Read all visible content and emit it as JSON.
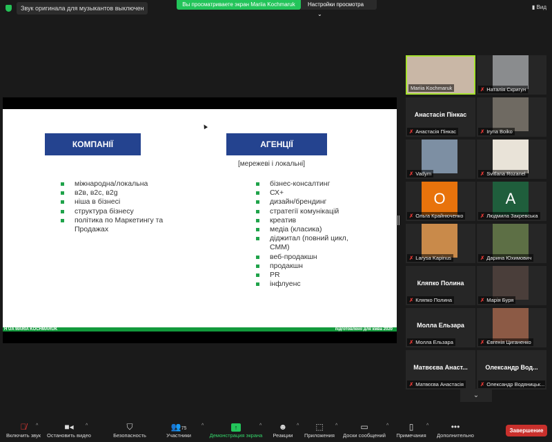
{
  "topbar": {
    "audio_note": "Звук оригинала для музыкантов выключен",
    "viewing": "Вы просматриваете экран Mariia Kochmaruk",
    "view_options": "Настройки просмотра",
    "view_button": "Вид"
  },
  "slide": {
    "left_header": "КОМПАНІЇ",
    "right_header": "АГЕНЦІЇ",
    "right_subheader": "[мережеві і локальні]",
    "left_items": [
      "міжнародна/локальна",
      "в2в, в2с, в2g",
      "ніша в бізнесі",
      "структура бізнесу",
      "політика по Маркетингу та Продажах"
    ],
    "right_items": [
      "бізнес-консалтинг",
      "СХ+",
      "дизайн/брендинг",
      "стратегії комунікацій",
      "креатив",
      "медіа (класика)",
      "діджитал (повний цикл, СММ)",
      "веб-продакшн",
      "продакшн",
      "PR",
      "інфлуенс"
    ],
    "footer_left": "H  UA   MARIA KOCHMARUK",
    "footer_right": "підготовлено для кмва  2020"
  },
  "participants": [
    {
      "name": "Mariia Kochmaruk",
      "type": "video",
      "color": "#c9b7a6",
      "muted": false,
      "active": true
    },
    {
      "name": "Наталія  Скригун",
      "type": "video",
      "color": "#8a8c8e",
      "muted": true
    },
    {
      "name": "Анастасія Пінкас",
      "type": "name",
      "big": "Анастасія Пінкас",
      "muted": true
    },
    {
      "name": "Iryna Boiko",
      "type": "video",
      "color": "#6f6a62",
      "muted": true
    },
    {
      "name": "Vadym",
      "type": "video",
      "color": "#7d8fa3",
      "muted": true
    },
    {
      "name": "Svitlana Rozanel",
      "type": "video",
      "color": "#e9e3d8",
      "muted": true
    },
    {
      "name": "Ольга Крайнюченко",
      "type": "letter",
      "letter": "O",
      "color": "#e8730c",
      "muted": true
    },
    {
      "name": "Людмила Закревська",
      "type": "letter",
      "letter": "A",
      "color": "#1f5e3c",
      "muted": true
    },
    {
      "name": "Larysa Kapinus",
      "type": "video",
      "color": "#c98a4a",
      "muted": true
    },
    {
      "name": "Дарина Юхимович",
      "type": "video",
      "color": "#5d6f45",
      "muted": true
    },
    {
      "name": "Кляпко Полина",
      "type": "name",
      "big": "Кляпко Полина",
      "muted": true
    },
    {
      "name": "Марія Буря",
      "type": "video",
      "color": "#4a3e3a",
      "muted": true
    },
    {
      "name": "Молла Ельзара",
      "type": "name",
      "big": "Молла Ельзара",
      "muted": true
    },
    {
      "name": "Євгенія Циганенко",
      "type": "video",
      "color": "#8c5a45",
      "muted": true
    },
    {
      "name": "Матвєєва Анастасія",
      "type": "name",
      "big": "Матвєєва Анаст...",
      "muted": true
    },
    {
      "name": "Олександр Водяницьк...",
      "type": "name",
      "big": "Олександр  Вод...",
      "muted": true
    }
  ],
  "toolbar": {
    "unmute": "Включить звук",
    "video": "Остановить видео",
    "security": "Безопасность",
    "participants": "Участники",
    "participants_count": "75",
    "share": "Демонстрация экрана",
    "reactions": "Реакции",
    "apps": "Приложения",
    "whiteboards": "Доски сообщений",
    "notes": "Примечания",
    "more": "Дополнительно",
    "end": "Завершение"
  }
}
